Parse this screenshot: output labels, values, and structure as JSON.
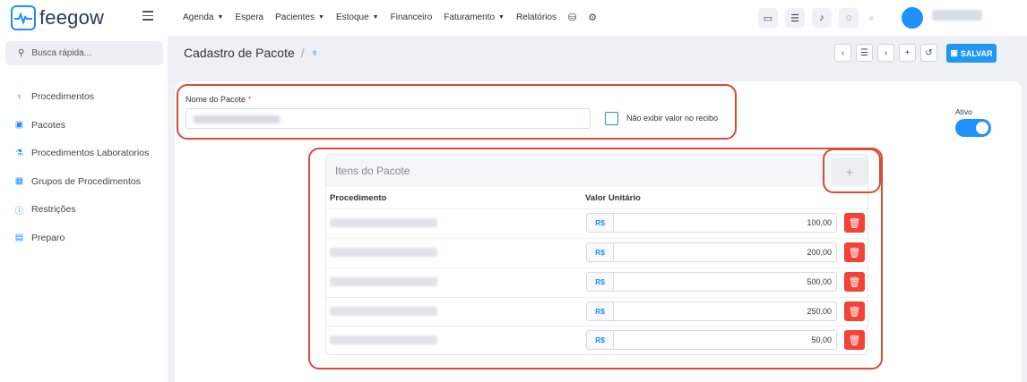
{
  "app": {
    "logo_text": "feegow",
    "brand_color": "#1e90ff"
  },
  "nav": {
    "items": [
      {
        "label": "Agenda",
        "dropdown": true
      },
      {
        "label": "Espera",
        "dropdown": false
      },
      {
        "label": "Pacientes",
        "dropdown": true
      },
      {
        "label": "Estoque",
        "dropdown": true
      },
      {
        "label": "Financeiro",
        "dropdown": false
      },
      {
        "label": "Faturamento",
        "dropdown": true
      },
      {
        "label": "Relatórios",
        "dropdown": false
      }
    ],
    "icons": [
      "database-icon",
      "gear-icon"
    ]
  },
  "topbar_icons": [
    "monitor-icon",
    "list-check-icon",
    "bell-icon",
    "chat-icon"
  ],
  "sidebar": {
    "search_placeholder": "Busca rápida...",
    "items": [
      {
        "label": "Procedimentos",
        "icon": "stethoscope-icon"
      },
      {
        "label": "Pacotes",
        "icon": "package-icon"
      },
      {
        "label": "Procedimentos Laboratorios",
        "icon": "flask-icon"
      },
      {
        "label": "Grupos de Procedimentos",
        "icon": "group-icon"
      },
      {
        "label": "Restrições",
        "icon": "info-circle-icon"
      },
      {
        "label": "Preparo",
        "icon": "list-icon"
      }
    ]
  },
  "header": {
    "title": "Cadastro de Pacote",
    "separator": "/"
  },
  "actions": {
    "save_label": "SALVAR"
  },
  "form": {
    "nome_label": "Nome do Pacote",
    "required_mark": "*",
    "checkbox_label": "Não exibir valor no recibo",
    "ativo_label": "Ativo",
    "ativo_on": true
  },
  "itens": {
    "title": "Itens do Pacote",
    "add_label": "+",
    "columns": [
      "Procedimento",
      "Valor Unitário"
    ],
    "currency": "R$",
    "rows": [
      {
        "valor": "100,00"
      },
      {
        "valor": "200,00"
      },
      {
        "valor": "500,00"
      },
      {
        "valor": "250,00"
      },
      {
        "valor": "50,00"
      }
    ]
  }
}
